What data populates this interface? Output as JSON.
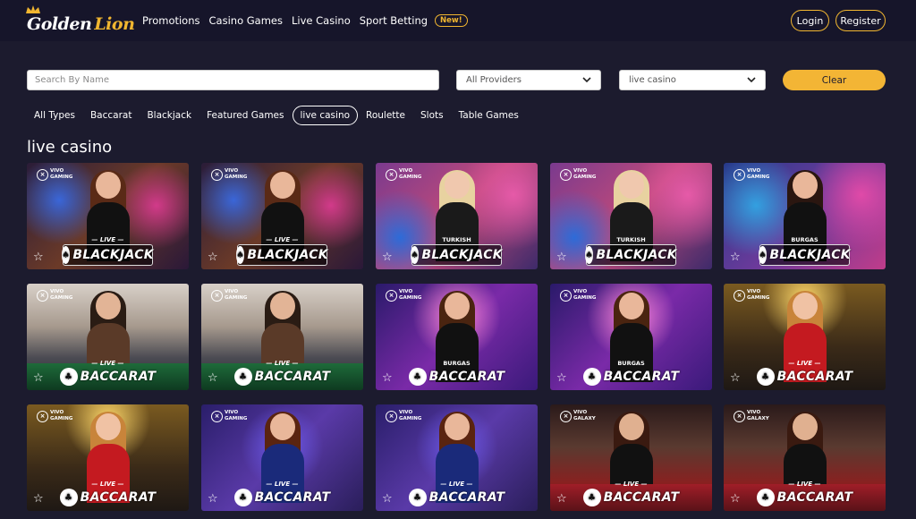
{
  "brand": {
    "logo_word1": "Golden",
    "logo_word2": "Lion",
    "accent": "#f1b630"
  },
  "nav": {
    "items": [
      "Promotions",
      "Casino Games",
      "Live Casino",
      "Sport Betting"
    ],
    "new_badge": "New!",
    "login": "Login",
    "register": "Register"
  },
  "filters": {
    "search_placeholder": "Search By Name",
    "provider_value": "All Providers",
    "category_value": "live casino",
    "clear_label": "Clear"
  },
  "tabs": {
    "items": [
      "All Types",
      "Baccarat",
      "Blackjack",
      "Featured Games",
      "live casino",
      "Roulette",
      "Slots",
      "Table Games"
    ],
    "active": "live casino"
  },
  "section_title": "live casino",
  "games": [
    {
      "title": "BLACKJACK",
      "live": "LIVE",
      "sub": "",
      "provider": "VIVO GAMING",
      "theme": "bj1"
    },
    {
      "title": "BLACKJACK",
      "live": "LIVE",
      "sub": "",
      "provider": "VIVO GAMING",
      "theme": "bj1"
    },
    {
      "title": "BLACKJACK",
      "live": "",
      "sub": "TURKISH",
      "provider": "VIVO GAMING",
      "theme": "bj2"
    },
    {
      "title": "BLACKJACK",
      "live": "",
      "sub": "TURKISH",
      "provider": "VIVO GAMING",
      "theme": "bj2"
    },
    {
      "title": "BLACKJACK",
      "live": "",
      "sub": "BURGAS",
      "provider": "VIVO GAMING",
      "theme": "bj3"
    },
    {
      "title": "BACCARAT",
      "live": "LIVE",
      "sub": "",
      "provider": "VIVO GAMING",
      "theme": "bc1"
    },
    {
      "title": "BACCARAT",
      "live": "LIVE",
      "sub": "",
      "provider": "VIVO GAMING",
      "theme": "bc1"
    },
    {
      "title": "BACCARAT",
      "live": "",
      "sub": "BURGAS",
      "provider": "VIVO GAMING",
      "theme": "bc2"
    },
    {
      "title": "BACCARAT",
      "live": "",
      "sub": "BURGAS",
      "provider": "VIVO GAMING",
      "theme": "bc2"
    },
    {
      "title": "BACCARAT",
      "live": "LIVE",
      "sub": "",
      "provider": "VIVO GAMING",
      "theme": "bc3"
    },
    {
      "title": "BACCARAT",
      "live": "LIVE",
      "sub": "",
      "provider": "VIVO GAMING",
      "theme": "bc3"
    },
    {
      "title": "BACCARAT",
      "live": "LIVE",
      "sub": "",
      "provider": "VIVO GAMING",
      "theme": "bc4"
    },
    {
      "title": "BACCARAT",
      "live": "LIVE",
      "sub": "",
      "provider": "VIVO GAMING",
      "theme": "bc4"
    },
    {
      "title": "BACCARAT",
      "live": "LIVE",
      "sub": "",
      "provider": "VIVO GALAXY",
      "theme": "bc5"
    },
    {
      "title": "BACCARAT",
      "live": "LIVE",
      "sub": "",
      "provider": "VIVO GALAXY",
      "theme": "bc5"
    }
  ]
}
